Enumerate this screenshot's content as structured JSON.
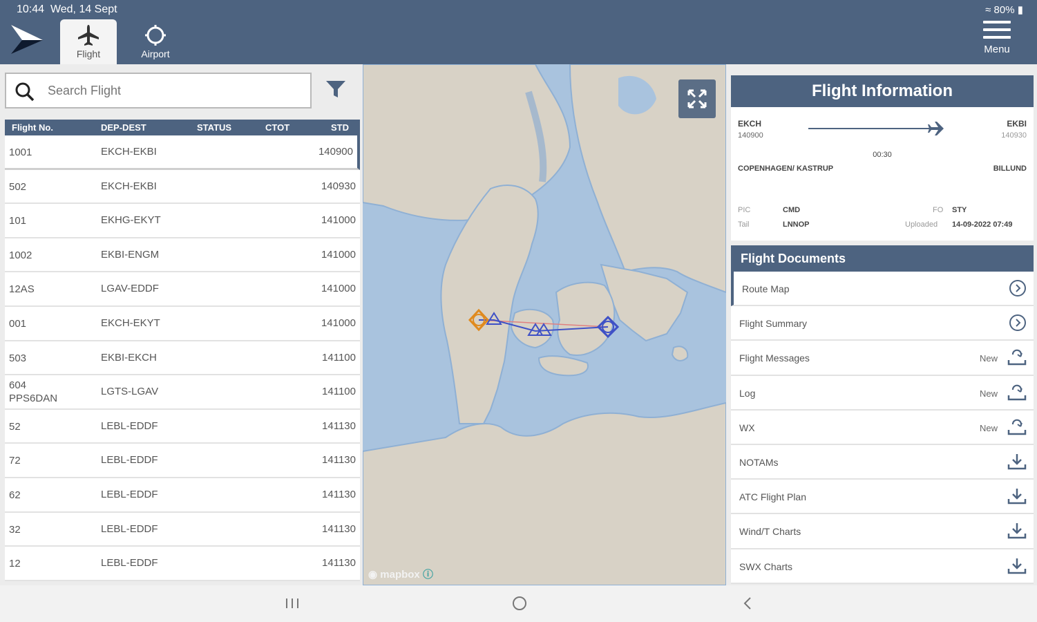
{
  "status_bar": {
    "time": "10:44",
    "date": "Wed, 14 Sept",
    "battery": "80%"
  },
  "colors": {
    "header": "#4d6380",
    "accent_orange": "#e08a1e",
    "route_blue": "#3f51c6"
  },
  "tabs": [
    {
      "label": "Flight",
      "icon": "airplane-icon",
      "active": true
    },
    {
      "label": "Airport",
      "icon": "crosshair-icon",
      "active": false
    }
  ],
  "menu": {
    "label": "Menu"
  },
  "search": {
    "placeholder": "Search Flight"
  },
  "table": {
    "headers": [
      "Flight No.",
      "DEP-DEST",
      "STATUS",
      "CTOT",
      "STD"
    ],
    "rows": [
      {
        "flight_no": "1001",
        "dep_dest": "EKCH-EKBI",
        "std": "140900"
      },
      {
        "flight_no": "502",
        "dep_dest": "EKCH-EKBI",
        "std": "140930"
      },
      {
        "flight_no": "101",
        "dep_dest": "EKHG-EKYT",
        "std": "141000"
      },
      {
        "flight_no": "1002",
        "dep_dest": "EKBI-ENGM",
        "std": "141000"
      },
      {
        "flight_no": "12AS",
        "dep_dest": "LGAV-EDDF",
        "std": "141000"
      },
      {
        "flight_no": "001",
        "dep_dest": "EKCH-EKYT",
        "std": "141000"
      },
      {
        "flight_no": "503",
        "dep_dest": "EKBI-EKCH",
        "std": "141100"
      },
      {
        "flight_no": "604\nPPS6DAN",
        "dep_dest": "LGTS-LGAV",
        "std": "141100"
      },
      {
        "flight_no": "52",
        "dep_dest": "LEBL-EDDF",
        "std": "141130"
      },
      {
        "flight_no": "72",
        "dep_dest": "LEBL-EDDF",
        "std": "141130"
      },
      {
        "flight_no": "62",
        "dep_dest": "LEBL-EDDF",
        "std": "141130"
      },
      {
        "flight_no": "32",
        "dep_dest": "LEBL-EDDF",
        "std": "141130"
      },
      {
        "flight_no": "12",
        "dep_dest": "LEBL-EDDF",
        "std": "141130"
      }
    ]
  },
  "map": {
    "attribution": "mapbox"
  },
  "flight_info": {
    "title": "Flight Information",
    "dep": "EKCH",
    "dep_time": "140900",
    "dest": "EKBI",
    "dest_time": "140930",
    "duration": "00:30",
    "dep_name": "COPENHAGEN/ KASTRUP",
    "dest_name": "BILLUND",
    "pic_label": "PIC",
    "pic_value": "CMD",
    "fo_label": "FO",
    "fo_value": "STY",
    "tail_label": "Tail",
    "tail_value": "LNNOP",
    "uploaded_label": "Uploaded",
    "uploaded_value": "14-09-2022 07:49"
  },
  "flight_documents": {
    "title": "Flight Documents",
    "items": [
      {
        "label": "Route Map",
        "badge": "",
        "icon": "chevron-right-circle-icon"
      },
      {
        "label": "Flight Summary",
        "badge": "",
        "icon": "chevron-right-circle-icon"
      },
      {
        "label": "Flight Messages",
        "badge": "New",
        "icon": "refresh-download-icon"
      },
      {
        "label": "Log",
        "badge": "New",
        "icon": "refresh-download-icon"
      },
      {
        "label": "WX",
        "badge": "New",
        "icon": "refresh-download-icon"
      },
      {
        "label": "NOTAMs",
        "badge": "",
        "icon": "download-icon"
      },
      {
        "label": "ATC Flight Plan",
        "badge": "",
        "icon": "download-icon"
      },
      {
        "label": "Wind/T Charts",
        "badge": "",
        "icon": "download-icon"
      },
      {
        "label": "SWX Charts",
        "badge": "",
        "icon": "download-icon"
      }
    ]
  }
}
